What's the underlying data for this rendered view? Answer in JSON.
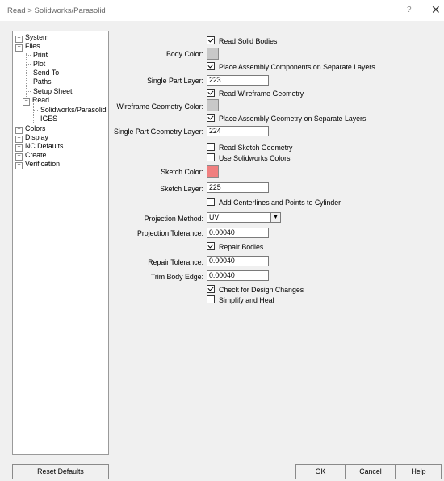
{
  "window": {
    "title": "Read > Solidworks/Parasolid",
    "help_glyph": "?",
    "close_glyph": "✕"
  },
  "tree": {
    "items": [
      {
        "label": "System",
        "toggle": "+",
        "level": 0
      },
      {
        "label": "Files",
        "toggle": "−",
        "level": 0
      },
      {
        "label": "Print",
        "level": 1
      },
      {
        "label": "Plot",
        "level": 1
      },
      {
        "label": "Send To",
        "level": 1
      },
      {
        "label": "Paths",
        "level": 1
      },
      {
        "label": "Setup Sheet",
        "level": 1
      },
      {
        "label": "Read",
        "toggle": "−",
        "level": 1
      },
      {
        "label": "Solidworks/Parasolid",
        "level": 2,
        "selected": true
      },
      {
        "label": "IGES",
        "level": 2
      },
      {
        "label": "Colors",
        "toggle": "+",
        "level": 0
      },
      {
        "label": "Display",
        "toggle": "+",
        "level": 0
      },
      {
        "label": "NC Defaults",
        "toggle": "+",
        "level": 0
      },
      {
        "label": "Create",
        "toggle": "+",
        "level": 0
      },
      {
        "label": "Verification",
        "toggle": "+",
        "level": 0
      }
    ]
  },
  "settings": {
    "read_solid_bodies": {
      "label": "Read Solid Bodies",
      "checked": true
    },
    "body_color": {
      "label": "Body Color:",
      "color": "#c8c8c8"
    },
    "place_assembly_components": {
      "label": "Place Assembly Components on Separate Layers",
      "checked": true
    },
    "single_part_layer": {
      "label": "Single Part Layer:",
      "value": "223"
    },
    "read_wireframe_geometry": {
      "label": "Read Wireframe Geometry",
      "checked": true
    },
    "wireframe_geometry_color": {
      "label": "Wireframe Geometry Color:",
      "color": "#c8c8c8"
    },
    "place_assembly_geometry": {
      "label": "Place Assembly Geometry on Separate Layers",
      "checked": true
    },
    "single_part_geometry_layer": {
      "label": "Single Part Geometry Layer:",
      "value": "224"
    },
    "read_sketch_geometry": {
      "label": "Read Sketch Geometry",
      "checked": false
    },
    "use_solidworks_colors": {
      "label": "Use Solidworks Colors",
      "checked": false
    },
    "sketch_color": {
      "label": "Sketch Color:",
      "color": "#f08080"
    },
    "sketch_layer": {
      "label": "Sketch Layer:",
      "value": "225"
    },
    "add_centerlines": {
      "label": "Add Centerlines and Points to Cylinder",
      "checked": false
    },
    "projection_method": {
      "label": "Projection Method:",
      "value": "UV"
    },
    "projection_tolerance": {
      "label": "Projection Tolerance:",
      "value": "0.00040"
    },
    "repair_bodies": {
      "label": "Repair Bodies",
      "checked": true
    },
    "repair_tolerance": {
      "label": "Repair Tolerance:",
      "value": "0.00040"
    },
    "trim_body_edge": {
      "label": "Trim Body Edge:",
      "value": "0.00040"
    },
    "check_design_changes": {
      "label": "Check for Design Changes",
      "checked": true
    },
    "simplify_and_heal": {
      "label": "Simplify and Heal",
      "checked": false
    }
  },
  "buttons": {
    "reset_defaults": "Reset Defaults",
    "ok": "OK",
    "cancel": "Cancel",
    "help": "Help"
  }
}
